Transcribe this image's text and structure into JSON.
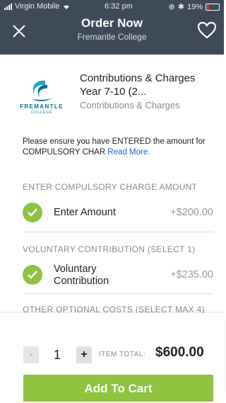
{
  "status_bar": {
    "carrier": "Virgin Mobile",
    "time": "6:32 pm",
    "battery": "19%"
  },
  "header": {
    "title": "Order Now",
    "subtitle": "Fremantle College"
  },
  "product": {
    "logo_text": "FREMANTLE",
    "logo_subtext": "COLLEGE",
    "title": "Contributions & Charges Year 7-10 (2...",
    "category": "Contributions & Charges"
  },
  "notice": {
    "text": "Please ensure you have ENTERED the amount for COMPULSORY CHAR ",
    "link": "Read More."
  },
  "sections": [
    {
      "heading": "ENTER COMPULSORY CHARGE AMOUNT",
      "item": {
        "label": "Enter Amount",
        "price": "+$200.00"
      }
    },
    {
      "heading": "VOLUNTARY CONTRIBUTION (SELECT 1)",
      "item": {
        "label": "Voluntary Contribution",
        "price": "+$235.00"
      }
    },
    {
      "heading": "OTHER OPTIONAL COSTS (SELECT MAX 4)"
    }
  ],
  "footer": {
    "minus": "-",
    "quantity": "1",
    "plus": "+",
    "total_label": "ITEM TOTAL:",
    "total_value": "$600.00",
    "cart_button": "Add To Cart"
  },
  "colors": {
    "header_bg": "#3f4a59",
    "accent_green": "#8fc23f",
    "link_blue": "#1b62d6"
  }
}
